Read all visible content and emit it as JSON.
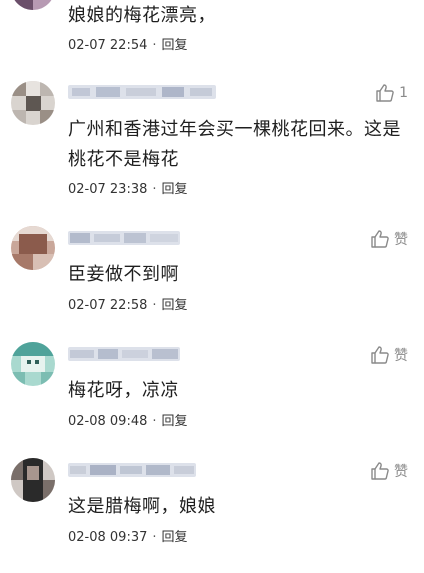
{
  "comments": [
    {
      "content": "娘娘的梅花漂亮，",
      "time": "02-07 22:54",
      "separator": "·",
      "reply_label": "回复",
      "like_text": "",
      "like_icon": "thumbs-up-icon",
      "avatar_colors": [
        "#6b4f6a",
        "#b79ab3",
        "#e8dce6"
      ]
    },
    {
      "content": "广州和香港过年会买一棵桃花回来。这是桃花不是梅花",
      "time": "02-07 23:38",
      "separator": "·",
      "reply_label": "回复",
      "like_text": "1",
      "like_icon": "thumbs-up-icon",
      "avatar_colors": [
        "#9a8f86",
        "#d9d4cf",
        "#5e5752"
      ]
    },
    {
      "content": "臣妾做不到啊",
      "time": "02-07 22:58",
      "separator": "·",
      "reply_label": "回复",
      "like_text": "赞",
      "like_icon": "thumbs-up-icon",
      "avatar_colors": [
        "#8b5b4c",
        "#c9a79a",
        "#e6d9d2"
      ]
    },
    {
      "content": "梅花呀，凉凉",
      "time": "02-08 09:48",
      "separator": "·",
      "reply_label": "回复",
      "like_text": "赞",
      "like_icon": "thumbs-up-icon",
      "avatar_colors": [
        "#4fa39a",
        "#a9d9cf",
        "#e7f3ef"
      ]
    },
    {
      "content": "这是腊梅啊，娘娘",
      "time": "02-08 09:37",
      "separator": "·",
      "reply_label": "回复",
      "like_text": "赞",
      "like_icon": "thumbs-up-icon",
      "avatar_colors": [
        "#2a2a2a",
        "#7a6f6a",
        "#cfc8c4"
      ]
    }
  ],
  "colors": {
    "blur_name": "#c7ccd9",
    "blur_name_dark": "#a9b0c2",
    "like_gray": "#8a8a8a"
  }
}
